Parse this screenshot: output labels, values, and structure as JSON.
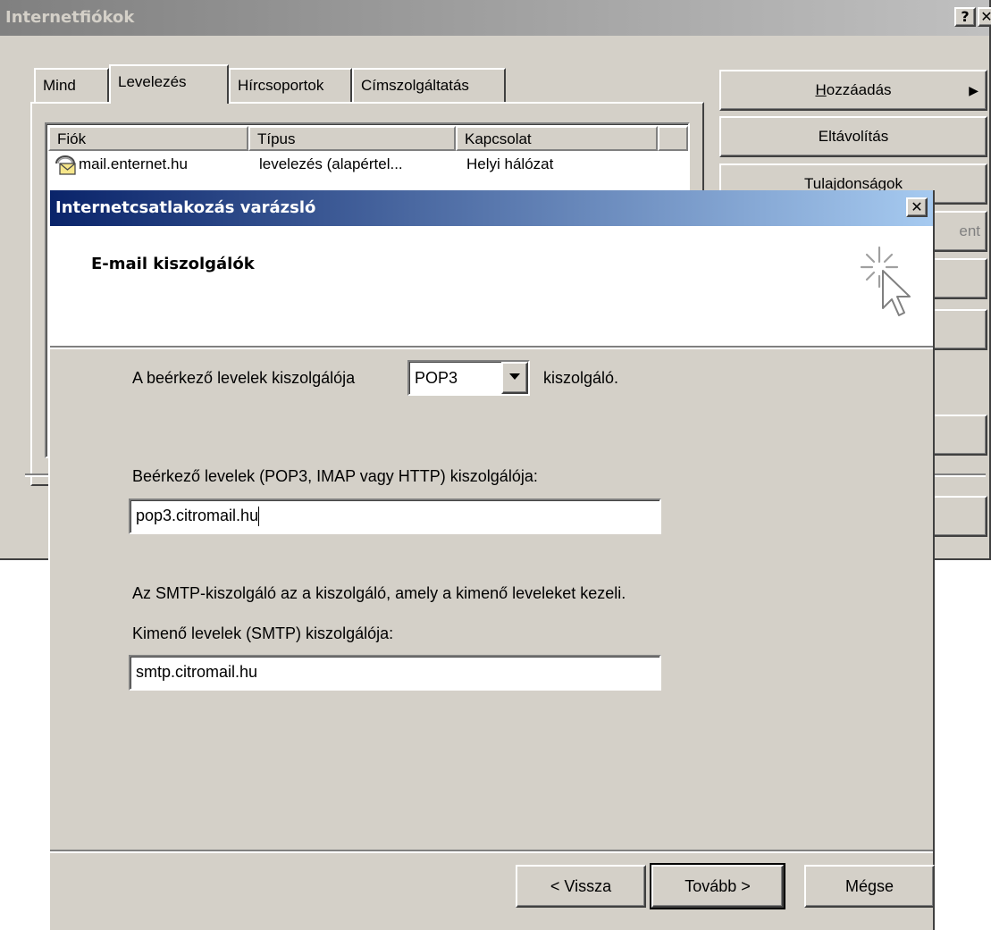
{
  "accounts_window": {
    "title": "Internetfiókok",
    "help_button": "?",
    "close_button": "✕",
    "tabs": [
      "Mind",
      "Levelezés",
      "Hírcsoportok",
      "Címszolgáltatás"
    ],
    "active_tab": "Levelezés",
    "columns": [
      "Fiók",
      "Típus",
      "Kapcsolat"
    ],
    "rows": [
      {
        "account": "mail.enternet.hu",
        "type": "levelezés (alapértel...",
        "connection": "Helyi hálózat",
        "icon": "mail-account-icon"
      }
    ],
    "side_buttons": {
      "add_hotkey": "H",
      "add_rest": "ozzáadás",
      "add_arrow": "▶",
      "remove": "Eltávolítás",
      "properties": "Tulajdonságok",
      "partial": "ent"
    }
  },
  "wizard": {
    "title": "Internetcsatlakozás varázsló",
    "close_button": "✕",
    "heading": "E-mail kiszolgálók",
    "icon": "wizard-sparkle-cursor-icon",
    "incoming_type_prefix": "A beérkező levelek kiszolgálója",
    "incoming_type_value": "POP3",
    "incoming_type_suffix": "kiszolgáló.",
    "incoming_label": "Beérkező levelek (POP3, IMAP vagy HTTP) kiszolgálója:",
    "incoming_value": "pop3.citromail.hu",
    "smtp_info": "Az SMTP-kiszolgáló az a kiszolgáló, amely a kimenő leveleket kezeli.",
    "outgoing_label": "Kimenő levelek (SMTP) kiszolgálója:",
    "outgoing_value": "smtp.citromail.hu",
    "buttons": {
      "back": "< Vissza",
      "next": "Tovább >",
      "cancel": "Mégse"
    }
  }
}
